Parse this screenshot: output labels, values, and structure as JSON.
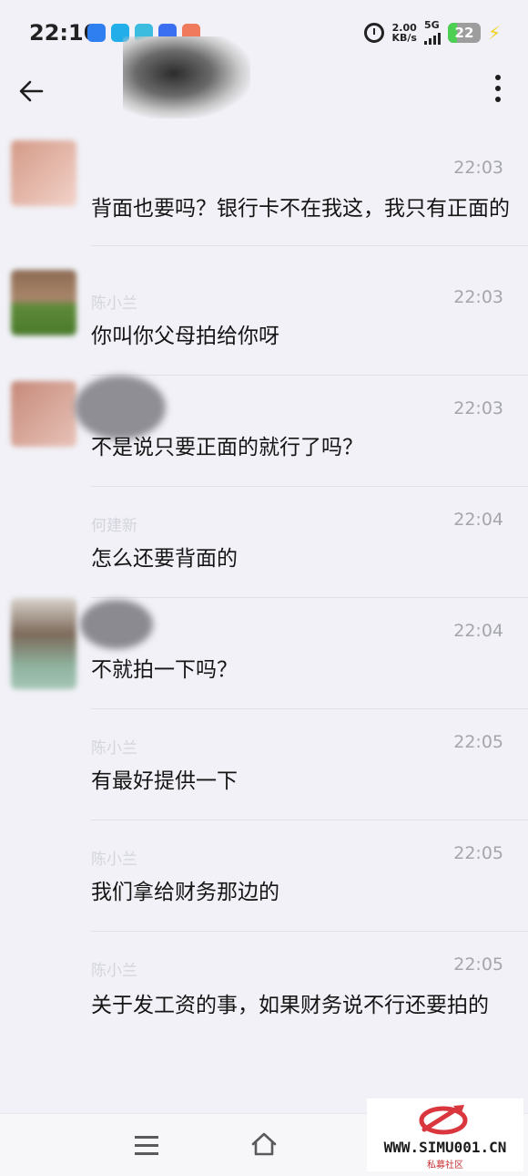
{
  "status_bar": {
    "time": "22:10",
    "speed_value": "2.00",
    "speed_unit": "KB/s",
    "network": "5G",
    "battery": "22",
    "alarm_icon": "alarm-clock-icon",
    "app_icon_colors": [
      "#2f7ff0",
      "#22aee8",
      "#3cbde0",
      "#3a6ff2",
      "#f07a5c"
    ]
  },
  "header": {
    "back_icon": "back-arrow-icon",
    "more_icon": "more-vertical-icon"
  },
  "messages": [
    {
      "time": "22:03",
      "text": "背面也要吗？银行卡不在我这，我只有正面的",
      "avatar_colors": [
        "#d49a87",
        "#f2d2c9"
      ]
    },
    {
      "time": "22:03",
      "name": "陈小兰",
      "text": "你叫你父母拍给你呀",
      "avatar_colors": [
        "#8b6a52",
        "#5e8a3a"
      ]
    },
    {
      "time": "22:03",
      "text": "不是说只要正面的就行了吗？",
      "avatar_colors": [
        "#c68a7a",
        "#e8c2b8"
      ]
    },
    {
      "time": "22:04",
      "name": "何建新",
      "text": "怎么还要背面的",
      "avatar_colors": []
    },
    {
      "time": "22:04",
      "text": "不就拍一下吗？",
      "avatar_colors": [
        "#7d6a5a",
        "#8fb3a0"
      ]
    },
    {
      "time": "22:05",
      "name": "陈小兰",
      "text": "有最好提供一下",
      "avatar_colors": []
    },
    {
      "time": "22:05",
      "name": "陈小兰",
      "text": "我们拿给财务那边的",
      "avatar_colors": []
    },
    {
      "time": "22:05",
      "name": "陈小兰",
      "text": "关于发工资的事，如果财务说不行还要拍的",
      "avatar_colors": []
    }
  ],
  "navbar": {
    "menu_icon": "menu-icon",
    "home_icon": "home-icon"
  },
  "watermark": {
    "url": "WWW.SIMU001.CN",
    "subtitle": "私募社区"
  }
}
